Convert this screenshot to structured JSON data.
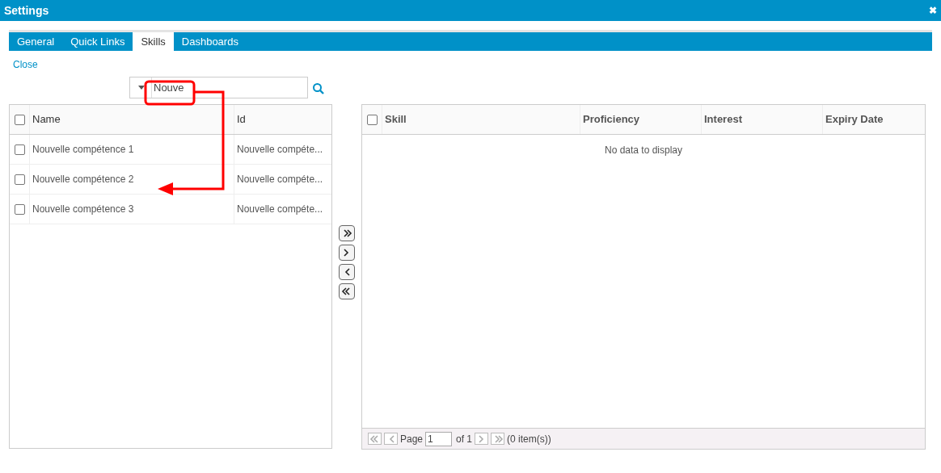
{
  "window": {
    "title": "Settings",
    "close": "✖"
  },
  "tabs": [
    {
      "label": "General",
      "selected": false
    },
    {
      "label": "Quick Links",
      "selected": false
    },
    {
      "label": "Skills",
      "selected": true
    },
    {
      "label": "Dashboards",
      "selected": false
    }
  ],
  "close_link": "Close",
  "search": {
    "value": "Nouve"
  },
  "available": {
    "select_all_checked": false,
    "columns": [
      "Name",
      "Id"
    ],
    "rows": [
      {
        "checked": false,
        "cells": [
          "Nouvelle compétence 1",
          "Nouvelle compéte..."
        ]
      },
      {
        "checked": false,
        "cells": [
          "Nouvelle compétence 2",
          "Nouvelle compéte..."
        ]
      },
      {
        "checked": false,
        "cells": [
          "Nouvelle compétence 3",
          "Nouvelle compéte..."
        ]
      }
    ]
  },
  "assigned": {
    "select_all_checked": false,
    "columns": [
      "Skill",
      "Proficiency",
      "Interest",
      "Expiry Date"
    ],
    "empty_message": "No data to display",
    "pager": {
      "page_label": "Page",
      "page": "1",
      "of": "of 1",
      "count": "(0 item(s))"
    }
  },
  "annotation": {
    "highlight": true,
    "arrow": true
  }
}
